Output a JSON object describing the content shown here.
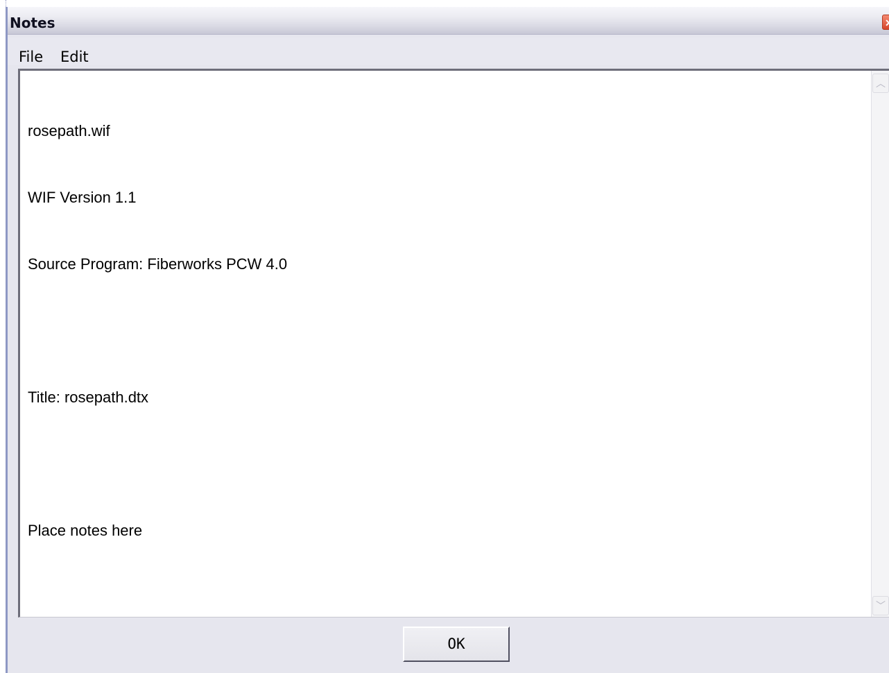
{
  "window": {
    "title": "Notes",
    "close_icon": "close-icon"
  },
  "menu": {
    "items": [
      {
        "label": "File"
      },
      {
        "label": "Edit"
      }
    ]
  },
  "notes": {
    "lines": [
      "rosepath.wif",
      "WIF Version 1.1",
      "Source Program: Fiberworks PCW 4.0",
      "",
      "Title: rosepath.dtx",
      "",
      "Place notes here"
    ]
  },
  "buttons": {
    "ok_label": "OK"
  },
  "colors": {
    "window_border": "#8e98c4",
    "close_button": "#d6452a"
  }
}
